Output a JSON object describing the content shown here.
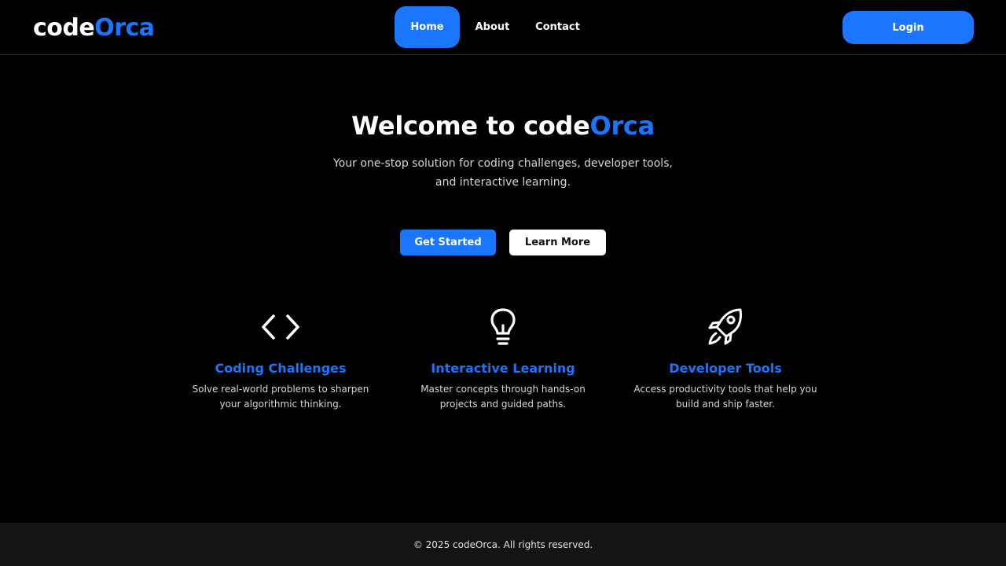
{
  "header": {
    "logo_prefix": "code",
    "logo_accent": "Orca",
    "nav": [
      {
        "label": "Home",
        "active": true
      },
      {
        "label": "About",
        "active": false
      },
      {
        "label": "Contact",
        "active": false
      }
    ],
    "login_label": "Login"
  },
  "hero": {
    "title_prefix": "Welcome to code",
    "title_accent": "Orca",
    "subtitle": "Your one-stop solution for coding challenges, developer tools, and interactive learning.",
    "primary_cta": "Get Started",
    "secondary_cta": "Learn More"
  },
  "features": [
    {
      "icon": "code-brackets-icon",
      "title": "Coding Challenges",
      "description": "Solve real-world problems to sharpen your algorithmic thinking."
    },
    {
      "icon": "lightbulb-icon",
      "title": "Interactive Learning",
      "description": "Master concepts through hands-on projects and guided paths."
    },
    {
      "icon": "rocket-icon",
      "title": "Developer Tools",
      "description": "Access productivity tools that help you build and ship faster."
    }
  ],
  "footer": {
    "copyright": "© 2025 codeOrca. All rights reserved."
  },
  "colors": {
    "accent": "#1a75ff",
    "background": "#000000",
    "footer_background": "#141414"
  }
}
